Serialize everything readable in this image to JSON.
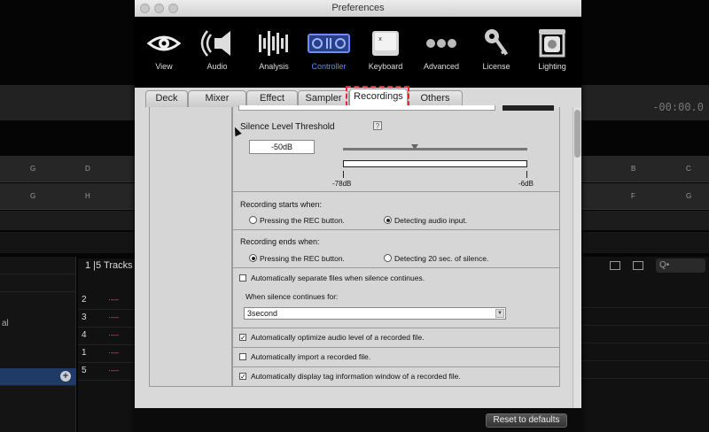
{
  "window": {
    "title": "Preferences"
  },
  "toolbar": {
    "items": [
      {
        "label": "View",
        "icon": "eye-icon"
      },
      {
        "label": "Audio",
        "icon": "speaker-icon"
      },
      {
        "label": "Analysis",
        "icon": "waveform-icon"
      },
      {
        "label": "Controller",
        "icon": "controller-icon",
        "active": true
      },
      {
        "label": "Keyboard",
        "icon": "keyboard-key-icon"
      },
      {
        "label": "Advanced",
        "icon": "more-dots-icon"
      },
      {
        "label": "License",
        "icon": "key-icon"
      },
      {
        "label": "Lighting",
        "icon": "moving-light-icon"
      }
    ],
    "active_color": "#5c8cff"
  },
  "tabs": [
    {
      "label": "Deck"
    },
    {
      "label": "Mixer"
    },
    {
      "label": "Effect"
    },
    {
      "label": "Sampler"
    },
    {
      "label": "Recordings",
      "active": true
    },
    {
      "label": "Others"
    }
  ],
  "recordings": {
    "silence_threshold_label": "Silence Level Threshold",
    "help_label": "?",
    "threshold_value": "-50dB",
    "meter_min_label": "-78dB",
    "meter_max_label": "-6dB",
    "slider_fraction": 0.39,
    "start_label": "Recording starts when:",
    "start_options": [
      "Pressing the REC button.",
      "Detecting audio input."
    ],
    "start_selected": 1,
    "end_label": "Recording ends when:",
    "end_options": [
      "Pressing the REC button.",
      "Detecting 20 sec. of silence."
    ],
    "end_selected": 0,
    "separate_files_label": "Automatically separate files when silence continues.",
    "separate_files_checked": false,
    "silence_continues_label": "When silence continues for:",
    "silence_duration_value": "3second",
    "optimize_label": "Automatically optimize audio level of a recorded file.",
    "optimize_checked": true,
    "import_label": "Automatically import a recorded file.",
    "import_checked": false,
    "tag_info_label": "Automatically display tag information window of a recorded file.",
    "tag_info_checked": true,
    "reset_label": "Reset to defaults"
  },
  "background": {
    "time_readout": "-00:00.0",
    "row1_keys": [
      "G",
      "D",
      "B",
      "C"
    ],
    "row2_keys": [
      "G",
      "H",
      "F",
      "G"
    ],
    "tracks_title": "1 |5 Tracks",
    "track_numbers": [
      "2",
      "3",
      "4",
      "1",
      "5"
    ],
    "left_label": "al",
    "search_placeholder": "Q•"
  }
}
